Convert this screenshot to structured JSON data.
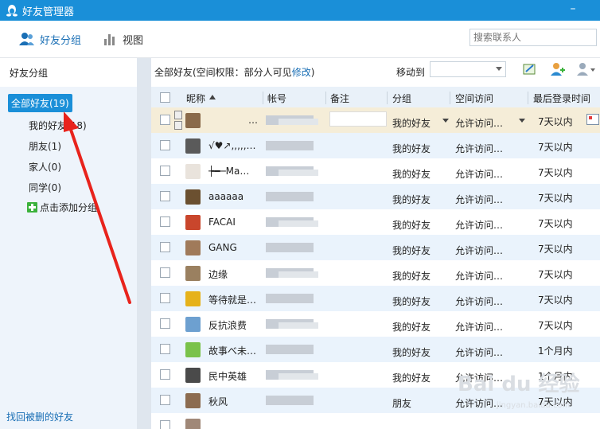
{
  "window": {
    "title": "好友管理器",
    "minimize": "–"
  },
  "toolbar": {
    "friends_group": "好友分组",
    "view": "视图",
    "search_placeholder": "搜索联系人"
  },
  "sidebar": {
    "header": "好友分组",
    "groups": [
      "全部好友(19)",
      "我的好友(18)",
      "朋友(1)",
      "家人(0)",
      "同学(0)"
    ],
    "add_group": "点击添加分组",
    "restore": "找回被删的好友"
  },
  "main": {
    "permission_prefix": "全部好友(空间权限：部分人可见",
    "permission_link": "修改",
    "permission_suffix": ")",
    "move_to": "移动到"
  },
  "table": {
    "headers": [
      "昵称",
      "帐号",
      "备注",
      "分组",
      "空间访问",
      "最后登录时间"
    ],
    "rows": [
      {
        "nick": "…",
        "group": "我的好友",
        "space": "允许访问…",
        "login": "7天以内",
        "avatar": "#8a6a4a"
      },
      {
        "nick": "√♥↗,,,,,…",
        "group": "我的好友",
        "space": "允许访问…",
        "login": "7天以内",
        "avatar": "#5a5a5a"
      },
      {
        "nick": "┾━─Ma…",
        "group": "我的好友",
        "space": "允许访问…",
        "login": "7天以内",
        "avatar": "#e9e3dc"
      },
      {
        "nick": "aaaaaa",
        "group": "我的好友",
        "space": "允许访问…",
        "login": "7天以内",
        "avatar": "#6b5030"
      },
      {
        "nick": "FACAI",
        "group": "我的好友",
        "space": "允许访问…",
        "login": "7天以内",
        "avatar": "#c9462c"
      },
      {
        "nick": "GANG",
        "group": "我的好友",
        "space": "允许访问…",
        "login": "7天以内",
        "avatar": "#a07a5a"
      },
      {
        "nick": "边缘",
        "group": "我的好友",
        "space": "允许访问…",
        "login": "7天以内",
        "avatar": "#9a8060"
      },
      {
        "nick": "等待就是…",
        "group": "我的好友",
        "space": "允许访问…",
        "login": "7天以内",
        "avatar": "#e6b21a"
      },
      {
        "nick": "反抗浪费",
        "group": "我的好友",
        "space": "允许访问…",
        "login": "7天以内",
        "avatar": "#6da0d0"
      },
      {
        "nick": "故事べ未…",
        "group": "我的好友",
        "space": "允许访问…",
        "login": "1个月内",
        "avatar": "#7ac24a"
      },
      {
        "nick": "民中英雄",
        "group": "我的好友",
        "space": "允许访问…",
        "login": "1个月内",
        "avatar": "#4a4a4a"
      },
      {
        "nick": "秋风",
        "group": "朋友",
        "space": "允许访问…",
        "login": "7天以内",
        "avatar": "#8c6c50"
      },
      {
        "nick": "",
        "group": "",
        "space": "",
        "login": "",
        "avatar": "#a08878"
      }
    ]
  },
  "colors": {
    "accent": "#1a8fd8",
    "link": "#1a6fb5",
    "annotation_arrow": "#e8231c",
    "row_alt": "#eaf3fc",
    "row_selected": "#f5edd8"
  },
  "watermark": {
    "text": "Bai du 经验",
    "url": "jingyan.baidu.com"
  }
}
